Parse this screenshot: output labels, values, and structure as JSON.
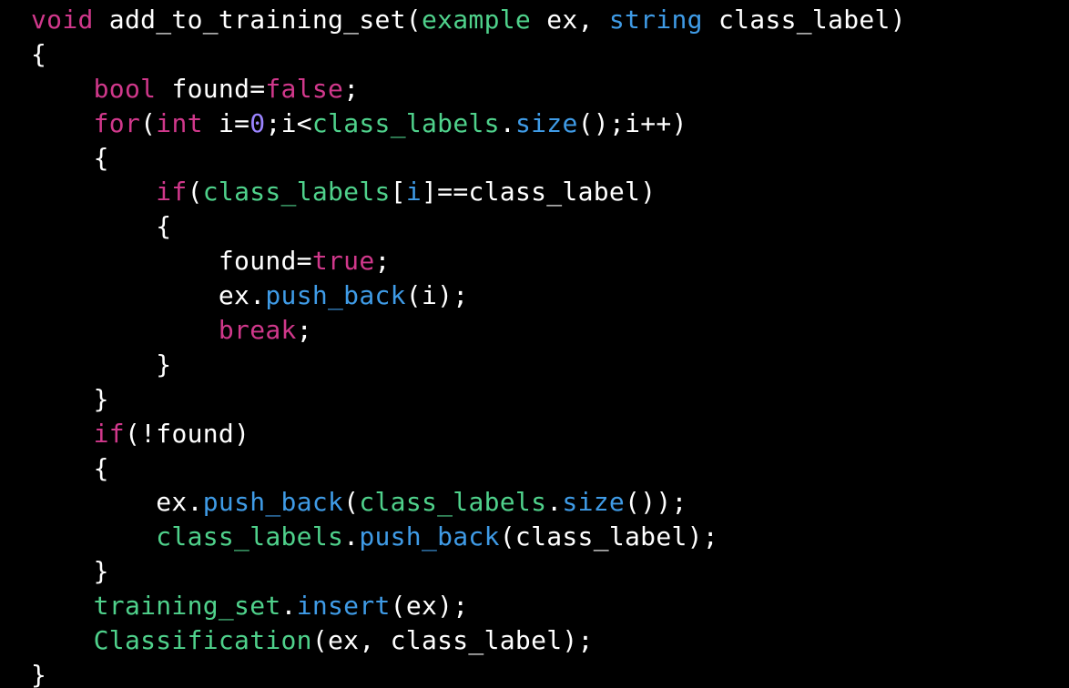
{
  "colors": {
    "background": "#000000",
    "plain": "#ffffff",
    "keyword": "#d0388b",
    "type": "#d0388b",
    "function": "#3f9be6",
    "identifier": "#4fd18b",
    "number": "#9b84ff"
  },
  "code": {
    "lines": [
      {
        "indent": 0,
        "tokens": [
          {
            "t": "void",
            "c": "keyword"
          },
          {
            "t": " add_to_training_set(",
            "c": "plain"
          },
          {
            "t": "example",
            "c": "identifier"
          },
          {
            "t": " ex, ",
            "c": "plain"
          },
          {
            "t": "string",
            "c": "function"
          },
          {
            "t": " class_label)",
            "c": "plain"
          }
        ]
      },
      {
        "indent": 0,
        "tokens": [
          {
            "t": "{",
            "c": "plain"
          }
        ]
      },
      {
        "indent": 1,
        "tokens": [
          {
            "t": "bool",
            "c": "keyword"
          },
          {
            "t": " found=",
            "c": "plain"
          },
          {
            "t": "false",
            "c": "keyword"
          },
          {
            "t": ";",
            "c": "plain"
          }
        ]
      },
      {
        "indent": 1,
        "tokens": [
          {
            "t": "for",
            "c": "keyword"
          },
          {
            "t": "(",
            "c": "plain"
          },
          {
            "t": "int",
            "c": "keyword"
          },
          {
            "t": " i=",
            "c": "plain"
          },
          {
            "t": "0",
            "c": "number"
          },
          {
            "t": ";i<",
            "c": "plain"
          },
          {
            "t": "class_labels",
            "c": "identifier"
          },
          {
            "t": ".",
            "c": "plain"
          },
          {
            "t": "size",
            "c": "function"
          },
          {
            "t": "();i++)",
            "c": "plain"
          }
        ]
      },
      {
        "indent": 1,
        "tokens": [
          {
            "t": "{",
            "c": "plain"
          }
        ]
      },
      {
        "indent": 2,
        "tokens": [
          {
            "t": "if",
            "c": "keyword"
          },
          {
            "t": "(",
            "c": "plain"
          },
          {
            "t": "class_labels",
            "c": "identifier"
          },
          {
            "t": "[",
            "c": "plain"
          },
          {
            "t": "i",
            "c": "function"
          },
          {
            "t": "]==class_label)",
            "c": "plain"
          }
        ]
      },
      {
        "indent": 2,
        "tokens": [
          {
            "t": "{",
            "c": "plain"
          }
        ]
      },
      {
        "indent": 3,
        "tokens": [
          {
            "t": "found=",
            "c": "plain"
          },
          {
            "t": "true",
            "c": "keyword"
          },
          {
            "t": ";",
            "c": "plain"
          }
        ]
      },
      {
        "indent": 3,
        "tokens": [
          {
            "t": "ex.",
            "c": "plain"
          },
          {
            "t": "push_back",
            "c": "function"
          },
          {
            "t": "(i);",
            "c": "plain"
          }
        ]
      },
      {
        "indent": 3,
        "tokens": [
          {
            "t": "break",
            "c": "keyword"
          },
          {
            "t": ";",
            "c": "plain"
          }
        ]
      },
      {
        "indent": 2,
        "tokens": [
          {
            "t": "}",
            "c": "plain"
          }
        ]
      },
      {
        "indent": 1,
        "tokens": [
          {
            "t": "}",
            "c": "plain"
          }
        ]
      },
      {
        "indent": 1,
        "tokens": [
          {
            "t": "if",
            "c": "keyword"
          },
          {
            "t": "(!found)",
            "c": "plain"
          }
        ]
      },
      {
        "indent": 1,
        "tokens": [
          {
            "t": "{",
            "c": "plain"
          }
        ]
      },
      {
        "indent": 2,
        "tokens": [
          {
            "t": "ex.",
            "c": "plain"
          },
          {
            "t": "push_back",
            "c": "function"
          },
          {
            "t": "(",
            "c": "plain"
          },
          {
            "t": "class_labels",
            "c": "identifier"
          },
          {
            "t": ".",
            "c": "plain"
          },
          {
            "t": "size",
            "c": "function"
          },
          {
            "t": "());",
            "c": "plain"
          }
        ]
      },
      {
        "indent": 2,
        "tokens": [
          {
            "t": "class_labels",
            "c": "identifier"
          },
          {
            "t": ".",
            "c": "plain"
          },
          {
            "t": "push_back",
            "c": "function"
          },
          {
            "t": "(class_label);",
            "c": "plain"
          }
        ]
      },
      {
        "indent": 1,
        "tokens": [
          {
            "t": "}",
            "c": "plain"
          }
        ]
      },
      {
        "indent": 1,
        "tokens": [
          {
            "t": "training_set",
            "c": "identifier"
          },
          {
            "t": ".",
            "c": "plain"
          },
          {
            "t": "insert",
            "c": "function"
          },
          {
            "t": "(ex);",
            "c": "plain"
          }
        ]
      },
      {
        "indent": 1,
        "tokens": [
          {
            "t": "Classification",
            "c": "identifier"
          },
          {
            "t": "(ex, class_label);",
            "c": "plain"
          }
        ]
      },
      {
        "indent": 0,
        "tokens": [
          {
            "t": "}",
            "c": "plain"
          }
        ]
      }
    ]
  }
}
